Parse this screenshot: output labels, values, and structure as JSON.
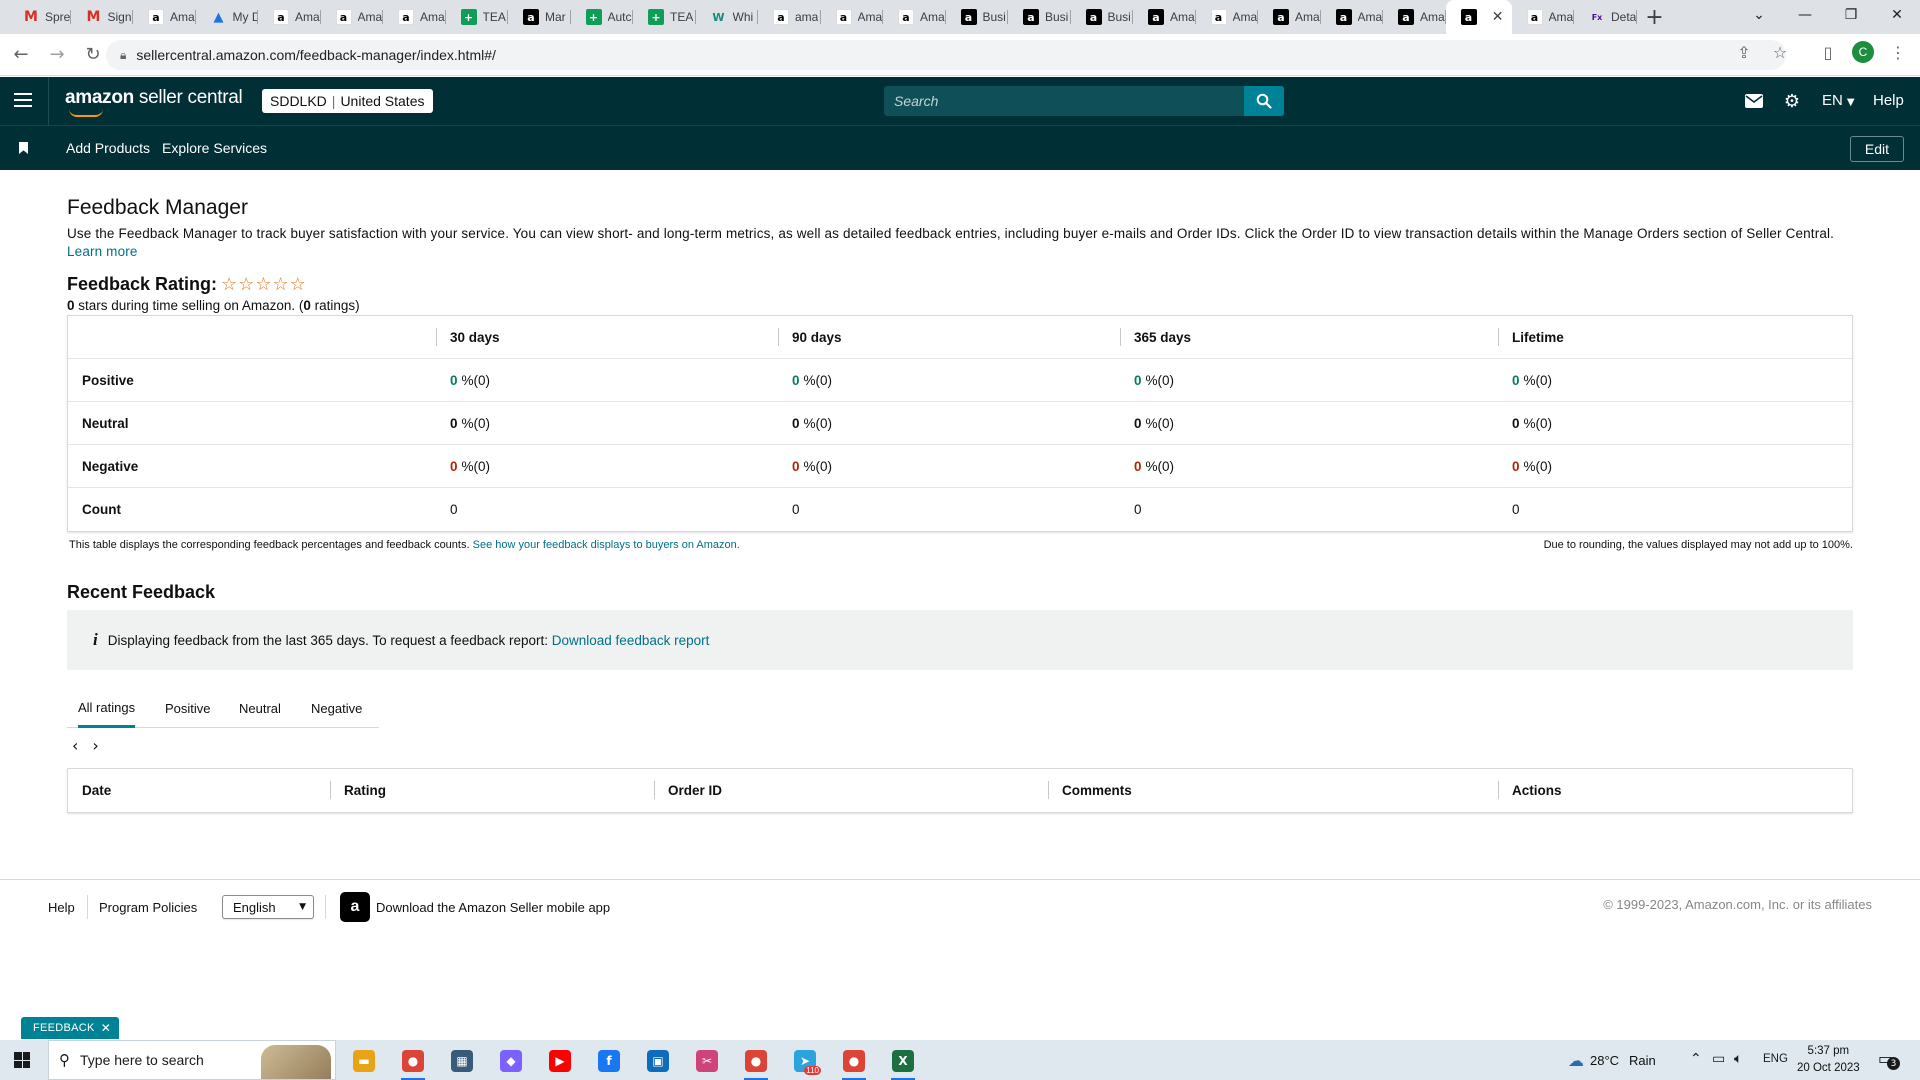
{
  "browser": {
    "tabs": [
      {
        "icon": "gmail-icon",
        "glyph": "M",
        "title": "Spre",
        "fav": "gmail"
      },
      {
        "icon": "gmail-icon",
        "glyph": "M",
        "title": "Sign",
        "fav": "gmail"
      },
      {
        "icon": "amazon-icon",
        "glyph": "a",
        "title": "Ama",
        "fav": "amazon-light"
      },
      {
        "icon": "drive-icon",
        "glyph": "▲",
        "title": "My D",
        "fav": "drive"
      },
      {
        "icon": "amazon-icon",
        "glyph": "a",
        "title": "Ama",
        "fav": "amazon-light"
      },
      {
        "icon": "amazon-icon",
        "glyph": "a",
        "title": "Ama",
        "fav": "amazon-light"
      },
      {
        "icon": "amazon-icon",
        "glyph": "a",
        "title": "Ama",
        "fav": "amazon-light"
      },
      {
        "icon": "sheets-icon",
        "glyph": "+",
        "title": "TEA",
        "fav": "sheets"
      },
      {
        "icon": "amazon-icon",
        "glyph": "a",
        "title": "Mar",
        "fav": "amazon"
      },
      {
        "icon": "sheets-icon",
        "glyph": "+",
        "title": "Autc",
        "fav": "sheets"
      },
      {
        "icon": "sheets-icon",
        "glyph": "+",
        "title": "TEA",
        "fav": "sheets"
      },
      {
        "icon": "whatsapp-icon",
        "glyph": "W",
        "title": "Whi",
        "fav": "wh"
      },
      {
        "icon": "amazon-icon",
        "glyph": "a",
        "title": "ama",
        "fav": "amazon-light"
      },
      {
        "icon": "amazon-icon",
        "glyph": "a",
        "title": "Ama",
        "fav": "amazon-light"
      },
      {
        "icon": "amazon-icon",
        "glyph": "a",
        "title": "Ama",
        "fav": "amazon-light"
      },
      {
        "icon": "amazon-icon",
        "glyph": "a",
        "title": "Busi",
        "fav": "amazon"
      },
      {
        "icon": "amazon-icon",
        "glyph": "a",
        "title": "Busi",
        "fav": "amazon"
      },
      {
        "icon": "amazon-icon",
        "glyph": "a",
        "title": "Busi",
        "fav": "amazon"
      },
      {
        "icon": "amazon-icon",
        "glyph": "a",
        "title": "Ama",
        "fav": "amazon"
      },
      {
        "icon": "amazon-icon",
        "glyph": "a",
        "title": "Ama",
        "fav": "amazon-light"
      },
      {
        "icon": "amazon-icon",
        "glyph": "a",
        "title": "Ama",
        "fav": "amazon"
      },
      {
        "icon": "amazon-icon",
        "glyph": "a",
        "title": "Ama",
        "fav": "amazon"
      },
      {
        "icon": "amazon-icon",
        "glyph": "a",
        "title": "Ama",
        "fav": "amazon"
      },
      {
        "icon": "amazon-icon",
        "glyph": "a",
        "title": "",
        "fav": "amazon",
        "active": true
      },
      {
        "icon": "amazon-icon",
        "glyph": "a",
        "title": "Ama",
        "fav": "amazon-light"
      },
      {
        "icon": "fedex-icon",
        "glyph": "Fx",
        "title": "Deta",
        "fav": "fedex"
      }
    ],
    "url": "sellercentral.amazon.com/feedback-manager/index.html#/",
    "profile_initial": "C"
  },
  "header": {
    "logo_bold": "amazon",
    "logo_rest": " seller central",
    "store": "SDDLKD",
    "marketplace": "United States",
    "search_placeholder": "Search",
    "language": "EN",
    "help": "Help"
  },
  "subnav": {
    "add_products": "Add Products",
    "explore_services": "Explore Services",
    "edit": "Edit"
  },
  "page": {
    "title": "Feedback Manager",
    "intro": "Use the Feedback Manager to track buyer satisfaction with your service. You can view short- and long-term metrics, as well as detailed feedback entries, including buyer e-mails and Order IDs. Click the Order ID to view transaction details within the Manage Orders section of Seller Central.",
    "learn_more": "Learn more",
    "rating_label": "Feedback Rating:",
    "rating_stars": 0,
    "rating_value": "0",
    "rating_text_a": " stars during time selling on Amazon. (",
    "rating_count": "0",
    "rating_text_b": " ratings)"
  },
  "summary_table": {
    "headers": [
      "30 days",
      "90 days",
      "365 days",
      "Lifetime"
    ],
    "rows": [
      {
        "label": "Positive",
        "kind": "green",
        "values": [
          "0",
          "0",
          "0",
          "0"
        ],
        "suffix": "%(0)"
      },
      {
        "label": "Neutral",
        "kind": "plain",
        "values": [
          "0",
          "0",
          "0",
          "0"
        ],
        "suffix": "%(0)"
      },
      {
        "label": "Negative",
        "kind": "red",
        "values": [
          "0",
          "0",
          "0",
          "0"
        ],
        "suffix": "%(0)"
      },
      {
        "label": "Count",
        "kind": "count",
        "values": [
          "0",
          "0",
          "0",
          "0"
        ],
        "suffix": ""
      }
    ],
    "note_left": "This table displays the corresponding feedback percentages and feedback counts.",
    "note_link": "See how your feedback displays to buyers on Amazon.",
    "note_right": "Due to rounding, the values displayed may not add up to 100%."
  },
  "recent": {
    "title": "Recent Feedback",
    "info_text": "Displaying feedback from the last 365 days. To request a feedback report:",
    "info_link": "Download feedback report",
    "tabs": [
      "All ratings",
      "Positive",
      "Neutral",
      "Negative"
    ],
    "selected_tab": "All ratings",
    "columns": [
      "Date",
      "Rating",
      "Order ID",
      "Comments",
      "Actions"
    ]
  },
  "footer": {
    "help": "Help",
    "program_policies": "Program Policies",
    "language": "English",
    "app_text": "Download the Amazon Seller mobile app",
    "copyright": "© 1999-2023, Amazon.com, Inc. or its affiliates"
  },
  "feedback_tag": "FEEDBACK",
  "taskbar": {
    "search_placeholder": "Type here to search",
    "weather_temp": "28°C",
    "weather_desc": "Rain",
    "lang": "ENG",
    "time": "5:37 pm",
    "date": "20 Oct 2023",
    "notif_count": "3",
    "telegram_badge": "110",
    "apps": [
      {
        "name": "file-explorer-icon",
        "color": "#e8a317",
        "glyph": "▬"
      },
      {
        "name": "chrome-icon",
        "color": "#db4437",
        "glyph": "●"
      },
      {
        "name": "calculator-icon",
        "color": "#3a5a7a",
        "glyph": "▦"
      },
      {
        "name": "copilot-icon",
        "color": "#7b61ff",
        "glyph": "◆"
      },
      {
        "name": "youtube-icon",
        "color": "#ff0000",
        "glyph": "▶"
      },
      {
        "name": "facebook-icon",
        "color": "#1877f2",
        "glyph": "f"
      },
      {
        "name": "store-icon",
        "color": "#0f6cbd",
        "glyph": "▣"
      },
      {
        "name": "snipping-tool-icon",
        "color": "#d0427a",
        "glyph": "✂"
      },
      {
        "name": "chrome-icon",
        "color": "#db4437",
        "glyph": "●"
      },
      {
        "name": "telegram-icon",
        "color": "#2aa3df",
        "glyph": "➤"
      },
      {
        "name": "chrome-icon",
        "color": "#db4437",
        "glyph": "●"
      },
      {
        "name": "excel-icon",
        "color": "#1d6f42",
        "glyph": "X"
      }
    ]
  }
}
